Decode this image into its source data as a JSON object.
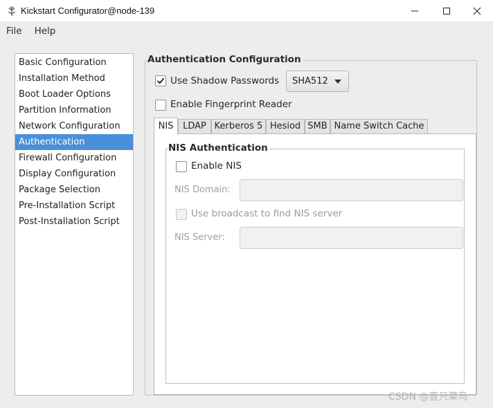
{
  "window": {
    "title": "Kickstart Configurator@node-139",
    "icon": "kickstart-app-icon",
    "controls": [
      "minimize-icon",
      "maximize-icon",
      "close-icon"
    ]
  },
  "menu": [
    "File",
    "Help"
  ],
  "sidebar": {
    "items": [
      {
        "label": "Basic Configuration"
      },
      {
        "label": "Installation Method"
      },
      {
        "label": "Boot Loader Options"
      },
      {
        "label": "Partition Information"
      },
      {
        "label": "Network Configuration"
      },
      {
        "label": "Authentication",
        "selected": true
      },
      {
        "label": "Firewall Configuration"
      },
      {
        "label": "Display Configuration"
      },
      {
        "label": "Package Selection"
      },
      {
        "label": "Pre-Installation Script"
      },
      {
        "label": "Post-Installation Script"
      }
    ],
    "selection_color": "#4a90d9"
  },
  "auth": {
    "title": "Authentication Configuration",
    "shadow": {
      "label": "Use Shadow Passwords",
      "checked": true
    },
    "hash_select": {
      "value": "SHA512"
    },
    "fingerprint": {
      "label": "Enable Fingerprint Reader",
      "checked": false
    },
    "tabs": [
      {
        "label": "NIS",
        "active": true
      },
      {
        "label": "LDAP"
      },
      {
        "label": "Kerberos 5"
      },
      {
        "label": "Hesiod"
      },
      {
        "label": "SMB"
      },
      {
        "label": "Name Switch Cache"
      }
    ],
    "nis": {
      "title": "NIS Authentication",
      "enable": {
        "label": "Enable NIS",
        "checked": false
      },
      "domain": {
        "label": "NIS Domain:",
        "value": ""
      },
      "broadcast": {
        "label": "Use broadcast to find NIS server",
        "checked": false,
        "disabled": true
      },
      "server": {
        "label": "NIS Server:",
        "value": ""
      }
    }
  },
  "watermark": "CSDN @壹只菜鸟"
}
